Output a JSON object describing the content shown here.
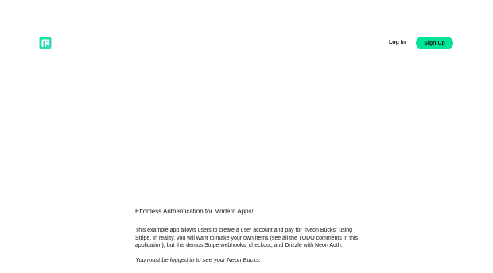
{
  "header": {
    "logo_icon": "neon-logo-icon",
    "brand_color": "#00e599",
    "login_label": "Log In",
    "signup_label": "Sign Up"
  },
  "main": {
    "heading": "Effortless Authentication for Modern Apps!",
    "description": "This example app allows users to create a user account and pay for \"Neon Bucks\" using Stripe. In reality, you will want to make your own items (see all the TODO comments in this application), but this demos Stripe webhooks, checkout, and Drizzle with Neon Auth.",
    "login_notice": "You must be logged in to see your Neon Bucks."
  }
}
